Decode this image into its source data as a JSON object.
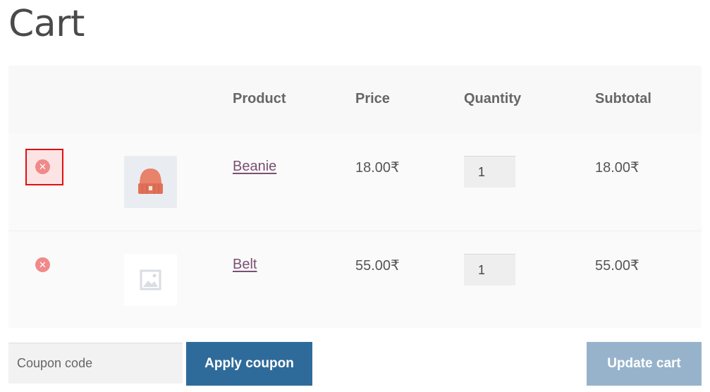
{
  "page": {
    "title": "Cart"
  },
  "table": {
    "headers": {
      "product": "Product",
      "price": "Price",
      "quantity": "Quantity",
      "subtotal": "Subtotal"
    },
    "rows": [
      {
        "name": "Beanie",
        "price": "18.00₹",
        "quantity": "1",
        "subtotal": "18.00₹",
        "thumbnail": "beanie-image",
        "remove_icon": "close-circle-icon"
      },
      {
        "name": "Belt",
        "price": "55.00₹",
        "quantity": "1",
        "subtotal": "55.00₹",
        "thumbnail": "placeholder-image-icon",
        "remove_icon": "close-circle-icon"
      }
    ]
  },
  "coupon": {
    "placeholder": "Coupon code",
    "apply_label": "Apply coupon"
  },
  "actions": {
    "update_label": "Update cart"
  },
  "colors": {
    "accent": "#2f6b9a",
    "update_button": "#97b3cc",
    "remove": "#f08a8a",
    "link": "#7b4f73",
    "highlight_border": "#e01010"
  }
}
